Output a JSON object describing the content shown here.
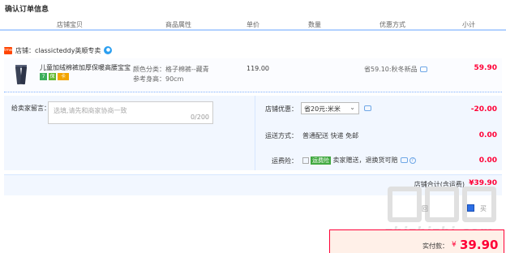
{
  "page": {
    "title": "确认订单信息"
  },
  "columns": [
    "店铺宝贝",
    "商品属性",
    "单价",
    "数量",
    "优惠方式",
    "小计"
  ],
  "shop": {
    "label": "店铺：",
    "name": "classicteddy英顺专卖",
    "icon_text": "tmall"
  },
  "item": {
    "title": "儿童加绒棉裤加厚保暖高腰宝宝...",
    "attr_color": "颜色分类：格子棉裤--藏青",
    "attr_height": "参考身高：90cm",
    "price": "119.00",
    "promo": "省59.10:秋冬新品",
    "subtotal": "59.90",
    "badges": [
      "7",
      "保",
      "卡"
    ]
  },
  "message": {
    "label": "给卖家留言：",
    "placeholder": "选填,请先和商家协商一致",
    "counter": "0/200"
  },
  "discount": {
    "label": "店铺优惠：",
    "selected": "省20元:米米",
    "amount": "-20.00"
  },
  "shipping": {
    "label": "运送方式：",
    "value": "普通配送 快递 免邮",
    "amount": "0.00"
  },
  "insurance": {
    "label": "运费险：",
    "tag": "运费险",
    "text": "卖家赠送，退换货可赔",
    "amount": "0.00"
  },
  "shop_total": {
    "label": "店铺合计(含运费)",
    "amount": "¥39.90"
  },
  "extras": {
    "left": "回",
    "right": "买"
  },
  "watermark": {
    "text": "zhizhizhi.com"
  },
  "pay": {
    "label": "实付款：",
    "currency": "¥",
    "amount": "39.90"
  },
  "colors": {
    "accent_red": "#ff0036",
    "header_border": "#b2d1ff",
    "panel_bg": "#f2f7ff"
  }
}
